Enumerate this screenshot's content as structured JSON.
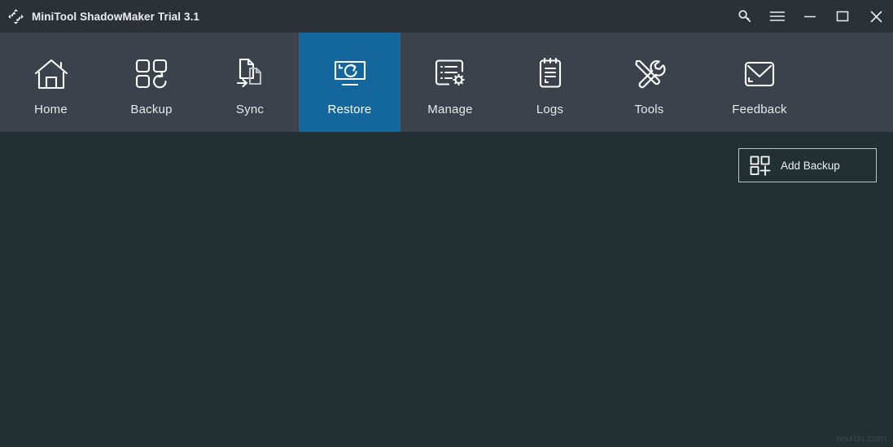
{
  "window": {
    "title": "MiniTool ShadowMaker Trial 3.1",
    "logo_icon": "circular-arrows-logo",
    "controls": [
      {
        "name": "key-icon",
        "label": "Register key"
      },
      {
        "name": "menu-icon",
        "label": "Menu"
      },
      {
        "name": "minimize-icon",
        "label": "Minimize"
      },
      {
        "name": "maximize-icon",
        "label": "Maximize"
      },
      {
        "name": "close-icon",
        "label": "Close"
      }
    ]
  },
  "nav": {
    "active": "Restore",
    "items": [
      {
        "label": "Home",
        "icon": "house-icon"
      },
      {
        "label": "Backup",
        "icon": "four-squares-refresh-icon"
      },
      {
        "label": "Sync",
        "icon": "two-documents-arrow-icon"
      },
      {
        "label": "Restore",
        "icon": "monitor-refresh-icon"
      },
      {
        "label": "Manage",
        "icon": "list-gear-icon"
      },
      {
        "label": "Logs",
        "icon": "notepad-icon"
      },
      {
        "label": "Tools",
        "icon": "screwdriver-wrench-icon"
      },
      {
        "label": "Feedback",
        "icon": "envelope-icon"
      }
    ]
  },
  "content": {
    "add_backup": {
      "label": "Add Backup",
      "icon": "squares-plus-icon"
    },
    "watermark": "wsxdn.com"
  },
  "colors": {
    "titlebar": "#2b3136",
    "navbar": "#3c424b",
    "nav_active": "#13679c",
    "content_bg": "#222f33",
    "text": "#e7eaec",
    "icon_stroke": "#ffffff"
  }
}
